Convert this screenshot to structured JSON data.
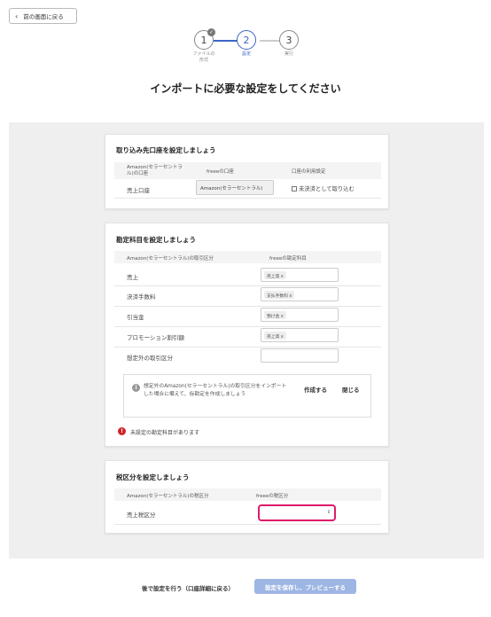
{
  "nav": {
    "back_label": "前の画面に戻る"
  },
  "stepper": {
    "steps": [
      {
        "number": "1",
        "label": "ファイルの\n形式",
        "state": "completed"
      },
      {
        "number": "2",
        "label": "設定",
        "state": "active"
      },
      {
        "number": "3",
        "label": "実行",
        "state": "pending"
      }
    ]
  },
  "page": {
    "title": "インポートに必要な設定をしてください"
  },
  "account_card": {
    "title": "取り込み先口座を設定しましょう",
    "headers": [
      "Amazon(セラーセントラル)の口座",
      "freeeの口座",
      "口座の利用設定"
    ],
    "row": {
      "label": "売上口座",
      "select_value": "Amazon(セラーセントラル)",
      "checkbox_label": "未決済として取り込む",
      "checked": false
    }
  },
  "category_card": {
    "title": "勘定科目を設定しましょう",
    "headers": [
      "Amazon(セラーセントラル)の取引区分",
      "freeeの勘定科目"
    ],
    "rows": [
      {
        "label": "売上",
        "tag": "売上高"
      },
      {
        "label": "決済手数料",
        "tag": "支払手数料"
      },
      {
        "label": "引当金",
        "tag": "預け金"
      },
      {
        "label": "プロモーション割引額",
        "tag": "売上高"
      },
      {
        "label": "想定外の取引区分",
        "tag": ""
      }
    ],
    "notice": {
      "text": "想定外のAmazon(セラーセントラル)の取引区分をインポートした場合に備えて、仮勘定を作成しましょう",
      "create_label": "作成する",
      "close_label": "閉じる"
    },
    "warning_text": "未設定の勘定科目があります"
  },
  "tax_card": {
    "title": "税区分を設定しましょう",
    "headers": [
      "Amazon(セラーセントラル)の税区分",
      "freeeの税区分"
    ],
    "row": {
      "label": "売上税区分",
      "select_value": ""
    }
  },
  "footer": {
    "later_label": "後で設定を行う（口座詳細に戻る）",
    "submit_label": "設定を保存し、プレビューする"
  },
  "colors": {
    "accent": "#3b65c7",
    "highlight": "#e0196a",
    "warning": "#d0232a",
    "disabled_button": "#9db6e4"
  }
}
